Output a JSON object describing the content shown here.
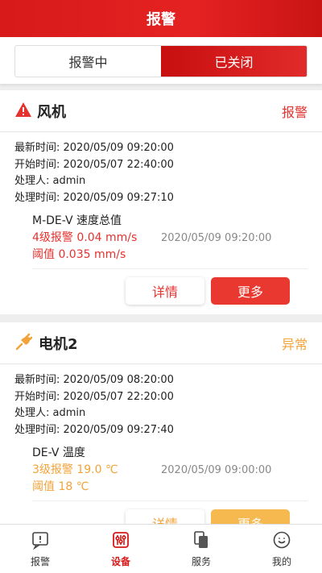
{
  "header": {
    "title": "报警"
  },
  "tabs": [
    {
      "label": "报警中",
      "active": false
    },
    {
      "label": "已关闭",
      "active": true
    }
  ],
  "cards": [
    {
      "title": "风机",
      "status": "报警",
      "status_color": "#e5322f",
      "icon": "warning-triangle-icon",
      "info": [
        "最新时间: 2020/05/09 09:20:00",
        "开始时间: 2020/05/07 22:40:00",
        "处理人: admin",
        "处理时间: 2020/05/09 09:27:10"
      ],
      "metric": {
        "name": "M-DE-V 速度总值",
        "level": "4级报警 0.04 mm/s",
        "threshold": "阈值 0.035 mm/s",
        "time": "2020/05/09 09:20:00",
        "color": "#e5322f"
      },
      "buttons": {
        "detail": "详情",
        "more": "更多"
      }
    },
    {
      "title": "电机2",
      "status": "异常",
      "status_color": "#f2a33a",
      "icon": "plug-icon",
      "info": [
        "最新时间: 2020/05/09 08:20:00",
        "开始时间: 2020/05/07 22:20:00",
        "处理人: admin",
        "处理时间: 2020/05/09 09:27:40"
      ],
      "metric": {
        "name": "DE-V 温度",
        "level": "3级报警 19.0 ℃",
        "threshold": "阈值 18 ℃",
        "time": "2020/05/09 09:00:00",
        "color": "#f2a33a"
      },
      "buttons": {
        "detail": "详情",
        "more": "更多"
      }
    }
  ],
  "bottom_nav": [
    {
      "label": "报警",
      "icon": "alarm-icon",
      "active": false
    },
    {
      "label": "设备",
      "icon": "equipment-icon",
      "active": true
    },
    {
      "label": "服务",
      "icon": "service-icon",
      "active": false
    },
    {
      "label": "我的",
      "icon": "profile-icon",
      "active": false
    }
  ]
}
